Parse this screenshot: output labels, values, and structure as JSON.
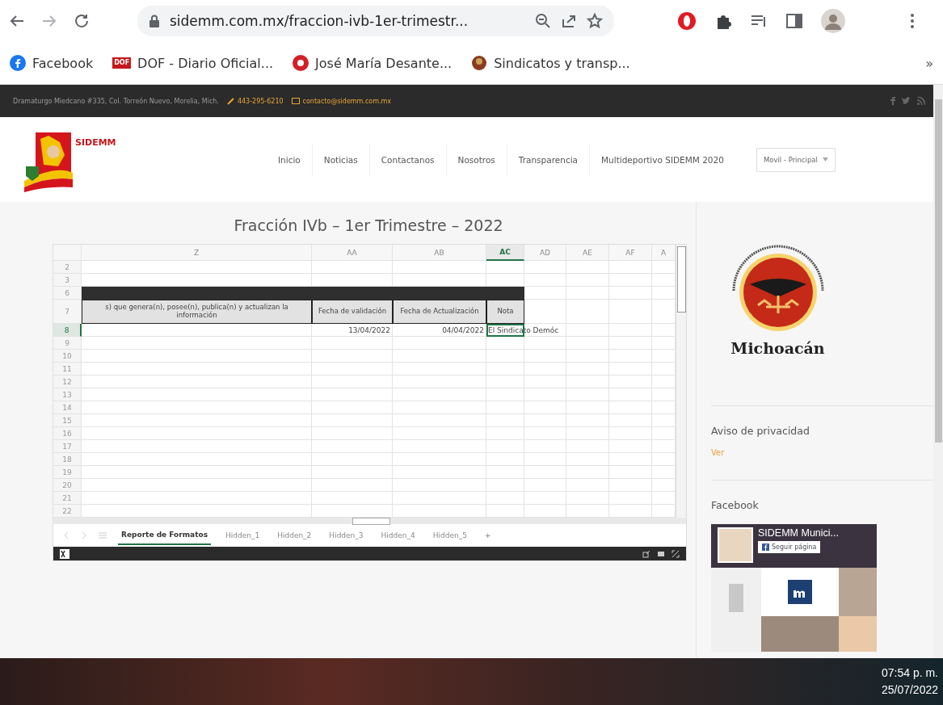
{
  "browser": {
    "url": "sidemm.com.mx/fraccion-ivb-1er-trimestr...",
    "overflow": "»",
    "bookmarks": [
      {
        "kind": "facebook",
        "label": "Facebook"
      },
      {
        "kind": "badge",
        "badge": "DOF",
        "label": "DOF - Diario Oficial..."
      },
      {
        "kind": "ring",
        "label": "José María Desante..."
      },
      {
        "kind": "emblem",
        "label": "Sindicatos y transp..."
      }
    ]
  },
  "topbar": {
    "address": "Dramaturgo Miedcano #335, Col. Torreón Nuevo, Morelia, Mich.",
    "phone": "443-295-6210",
    "email": "contacto@sidemm.com.mx"
  },
  "header": {
    "logo_text": "SIDEMM",
    "nav": [
      "Inicio",
      "Noticias",
      "Contactanos",
      "Nosotros",
      "Transparencia",
      "Multideportivo SIDEMM 2020"
    ],
    "menu_select": "Movil - Principal"
  },
  "page_title": "Fracción IVb – 1er Trimestre – 2022",
  "sheet": {
    "columns": [
      {
        "label": "Z",
        "selected": false
      },
      {
        "label": "AA",
        "selected": false
      },
      {
        "label": "AB",
        "selected": false
      },
      {
        "label": "AC",
        "selected": true
      },
      {
        "label": "AD",
        "selected": false
      },
      {
        "label": "AE",
        "selected": false
      },
      {
        "label": "AF",
        "selected": false
      },
      {
        "label": "A",
        "selected": false
      }
    ],
    "rows": [
      {
        "number": "2",
        "kind": "blank",
        "selected": false
      },
      {
        "number": "3",
        "kind": "blank",
        "selected": false
      },
      {
        "number": "6",
        "kind": "band",
        "selected": false
      },
      {
        "number": "7",
        "kind": "header",
        "selected": false,
        "cells": [
          "s) que genera(n), posee(n), publica(n) y actualizan la información",
          "Fecha de validación",
          "Fecha de Actualización",
          "Nota"
        ]
      },
      {
        "number": "8",
        "kind": "data",
        "selected": true,
        "cells": [
          {
            "text": "",
            "active": false
          },
          {
            "text": "13/04/2022",
            "active": false
          },
          {
            "text": "04/04/2022",
            "active": false
          },
          {
            "text": "El Sindicato Demóc",
            "active": true
          }
        ]
      },
      {
        "number": "9",
        "kind": "blank",
        "selected": false
      },
      {
        "number": "10",
        "kind": "blank",
        "selected": false
      },
      {
        "number": "11",
        "kind": "blank",
        "selected": false
      },
      {
        "number": "12",
        "kind": "blank",
        "selected": false
      },
      {
        "number": "13",
        "kind": "blank",
        "selected": false
      },
      {
        "number": "14",
        "kind": "blank",
        "selected": false
      },
      {
        "number": "15",
        "kind": "blank",
        "selected": false
      },
      {
        "number": "16",
        "kind": "blank",
        "selected": false
      },
      {
        "number": "17",
        "kind": "blank",
        "selected": false
      },
      {
        "number": "18",
        "kind": "blank",
        "selected": false
      },
      {
        "number": "19",
        "kind": "blank",
        "selected": false
      },
      {
        "number": "20",
        "kind": "blank",
        "selected": false
      },
      {
        "number": "21",
        "kind": "blank",
        "selected": false
      },
      {
        "number": "22",
        "kind": "blank",
        "selected": false
      }
    ],
    "tabs": [
      {
        "label": "Reporte de Formatos",
        "selected": true
      },
      {
        "label": "Hidden_1",
        "selected": false
      },
      {
        "label": "Hidden_2",
        "selected": false
      },
      {
        "label": "Hidden_3",
        "selected": false
      },
      {
        "label": "Hidden_4",
        "selected": false
      },
      {
        "label": "Hidden_5",
        "selected": false
      }
    ],
    "add_tab": "+"
  },
  "sidebar": {
    "logo_caption": "Michoacán",
    "privacy_title": "Aviso de privacidad",
    "privacy_link": "Ver",
    "facebook_title": "Facebook",
    "fb_page_name": "SIDEMM Munici...",
    "fb_follow": "Seguir página"
  },
  "taskbar": {
    "time": "07:54 p. m.",
    "date": "25/07/2022"
  }
}
